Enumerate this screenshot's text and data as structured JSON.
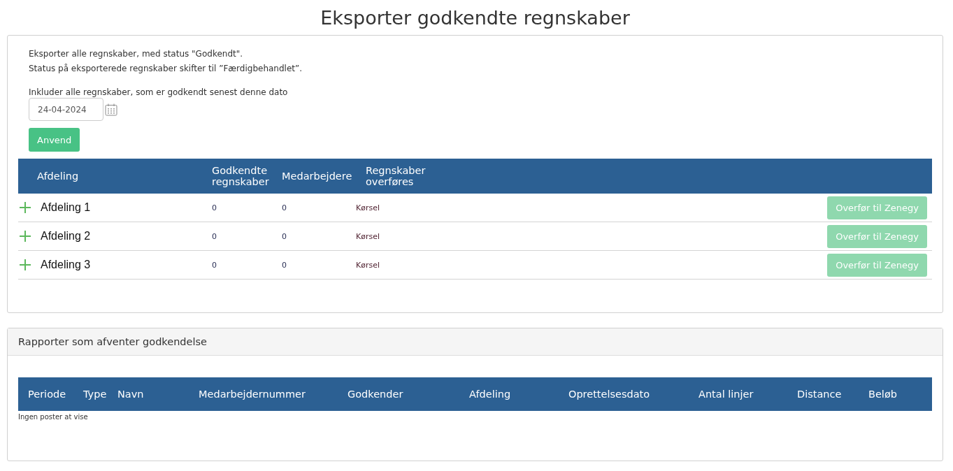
{
  "page_title": "Eksporter godkendte regnskaber",
  "export_panel": {
    "intro_lines": [
      "Eksporter alle regnskaber, med status \"Godkendt\".",
      "Status på eksporterede regnskaber skifter til ”Færdigbehandlet”."
    ],
    "date_label": "Inkluder alle regnskaber, som er godkendt senest denne dato",
    "date_field": {
      "value": "24-04-2024"
    },
    "apply_button": "Anvend",
    "table": {
      "columns": [
        "Afdeling",
        "Godkendte regnskaber",
        "Medarbejdere",
        "Regnskaber overføres"
      ],
      "rows": [
        {
          "expanded": false,
          "name": "Afdeling 1",
          "approved": "0",
          "employees": "0",
          "transfer_type": "Kørsel",
          "button": {
            "label": "Overfør til Zenegy",
            "disabled": true
          }
        },
        {
          "expanded": false,
          "name": "Afdeling 2",
          "approved": "0",
          "employees": "0",
          "transfer_type": "Kørsel",
          "button": {
            "label": "Overfør til Zenegy",
            "disabled": true
          }
        },
        {
          "expanded": false,
          "name": "Afdeling 3",
          "approved": "0",
          "employees": "0",
          "transfer_type": "Kørsel",
          "button": {
            "label": "Overfør til Zenegy",
            "disabled": true
          }
        }
      ]
    }
  },
  "pending_panel": {
    "title": "Rapporter som afventer godkendelse",
    "table": {
      "columns": [
        "Periode",
        "Type",
        "Navn",
        "Medarbejdernummer",
        "Godkender",
        "Afdeling",
        "Oprettelsesdato",
        "Antal linjer",
        "Distance",
        "Beløb"
      ],
      "empty_message": "Ingen poster at vise"
    }
  }
}
